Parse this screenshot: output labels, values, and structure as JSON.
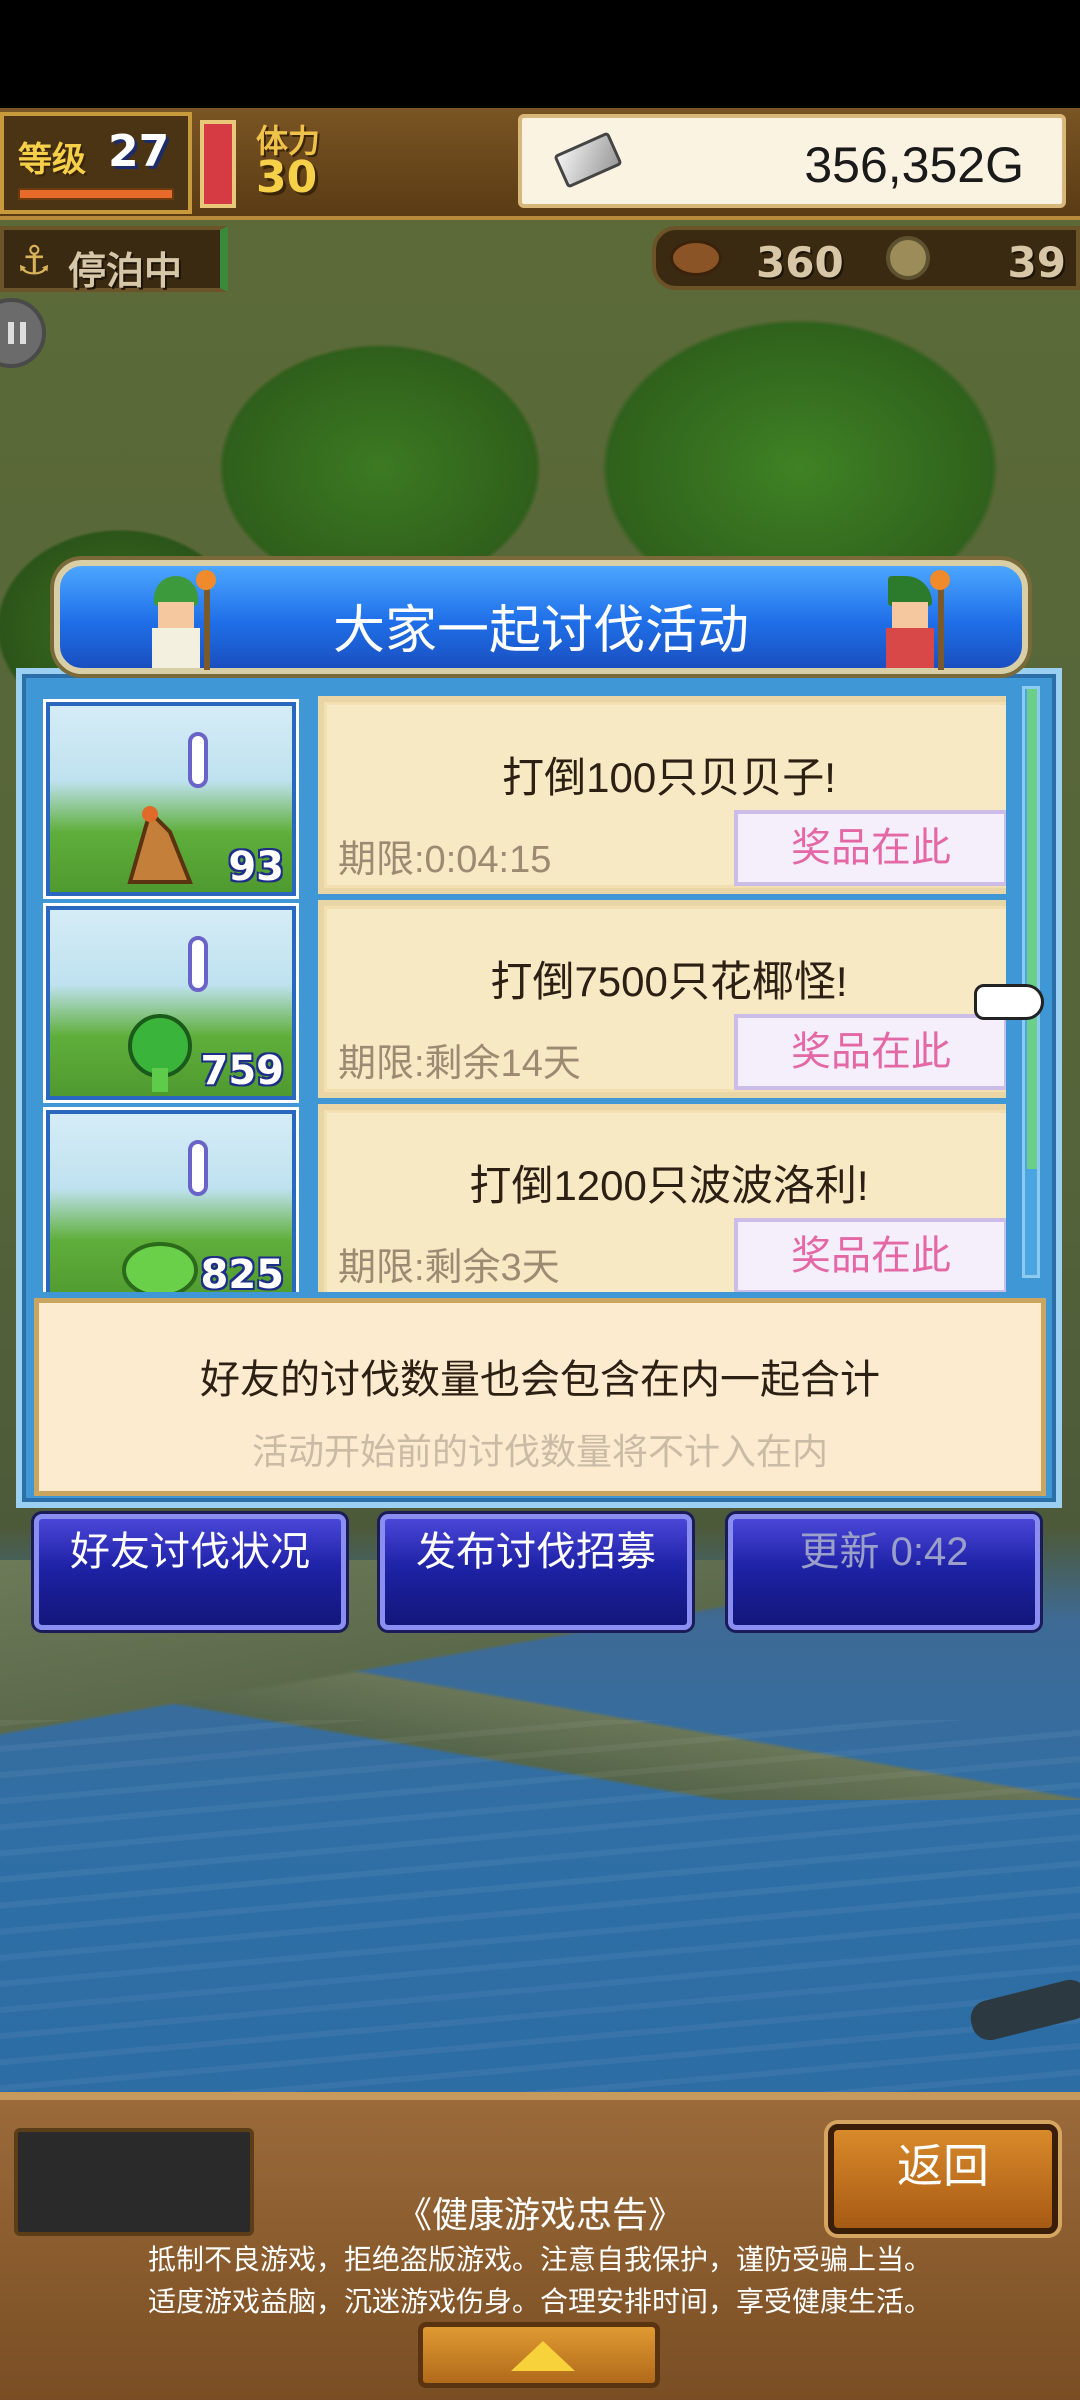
{
  "hud": {
    "level_label": "等级",
    "level_value": "27",
    "stamina_label": "体力",
    "stamina_value": "30",
    "gold": "356,352G",
    "status_label": "停泊中",
    "resource_meat": "360",
    "resource_coin": "39"
  },
  "panel": {
    "title": "大家一起讨伐活动",
    "quests": [
      {
        "title": "打倒100只贝贝子!",
        "deadline": "期限:0:04:15",
        "prize_label": "奖品在此",
        "count": "93",
        "monster_icon": "hermit-crab-monster"
      },
      {
        "title": "打倒7500只花椰怪!",
        "deadline": "期限:剩余14天",
        "prize_label": "奖品在此",
        "count": "759",
        "monster_icon": "broccoli-monster"
      },
      {
        "title": "打倒1200只波波洛利!",
        "deadline": "期限:剩余3天",
        "prize_label": "奖品在此",
        "count": "825",
        "monster_icon": "green-slime-monster"
      }
    ],
    "info_main": "好友的讨伐数量也会包含在内一起合计",
    "info_sub": "活动开始前的讨伐数量将不计入在内"
  },
  "actions": {
    "friend_status": "好友讨伐状况",
    "post_recruit": "发布讨伐招募",
    "refresh": "更新 0:42"
  },
  "footer": {
    "back": "返回",
    "notice_title": "《健康游戏忠告》",
    "notice_line1": "抵制不良游戏，拒绝盗版游戏。注意自我保护，谨防受骗上当。",
    "notice_line2": "适度游戏益脑，沉迷游戏伤身。合理安排时间，享受健康生活。"
  },
  "colors": {
    "panel_blue": "#3f97d6",
    "title_bar_blue": "#1f6fe8",
    "prize_pink": "#e468a6",
    "card_bg": "#f8e9c5",
    "button_indigo": "#1e22a6"
  }
}
